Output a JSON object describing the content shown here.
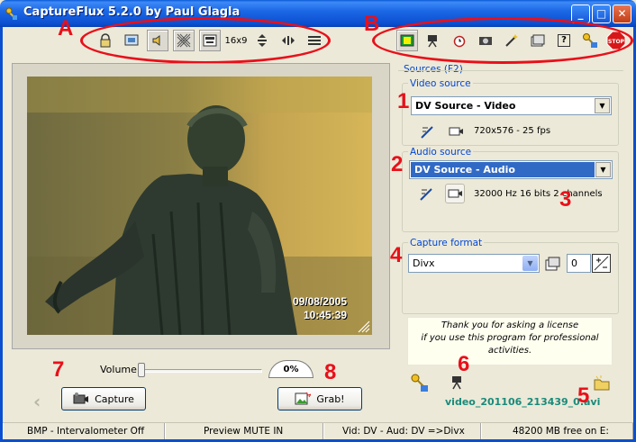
{
  "window": {
    "title": "CaptureFlux 5.2.0 by Paul Glagla",
    "minimize": "_",
    "maximize": "□",
    "close": "✕"
  },
  "toolbar_left": {
    "buttons": [
      {
        "icon": "lock-icon"
      },
      {
        "icon": "display-icon"
      },
      {
        "icon": "speaker-icon",
        "pressed": true
      },
      {
        "icon": "noise-icon",
        "pressed": true
      },
      {
        "icon": "subtitle-icon",
        "pressed": true
      },
      {
        "icon": "aspect-16x9",
        "label": "16x9"
      },
      {
        "icon": "vertical-resize-icon"
      },
      {
        "icon": "horizontal-resize-icon"
      },
      {
        "icon": "lines-icon"
      }
    ]
  },
  "toolbar_right": {
    "buttons": [
      {
        "icon": "film-icon",
        "pressed": true
      },
      {
        "icon": "camera-tripod-icon"
      },
      {
        "icon": "alarm-clock-icon"
      },
      {
        "icon": "camera-icon"
      },
      {
        "icon": "wand-icon"
      },
      {
        "icon": "properties-icon"
      },
      {
        "icon": "help-icon",
        "label": "?"
      },
      {
        "icon": "key-icon"
      },
      {
        "icon": "stop-icon",
        "label": "STOP"
      }
    ]
  },
  "annotations": {
    "A": "A",
    "B": "B",
    "n1": "1",
    "n2": "2",
    "n3": "3",
    "n4": "4",
    "n5": "5",
    "n6": "6",
    "n7": "7",
    "n8": "8"
  },
  "video": {
    "date": "09/08/2005",
    "time": "10:45:39"
  },
  "sources": {
    "title": "Sources (F2)",
    "video_label": "Video source",
    "video_value": "DV Source - Video",
    "video_info": "720x576 - 25 fps",
    "audio_label": "Audio source",
    "audio_value": "DV Source - Audio",
    "audio_info": "32000 Hz 16 bits 2 channels"
  },
  "capture_format": {
    "label": "Capture format",
    "value": "Divx",
    "spin_value": "0"
  },
  "license": {
    "line1": "Thank you for asking a license",
    "line2": "if you use this program for professional",
    "line3": "activities."
  },
  "output_file": "video_201106_213439_0.avi",
  "volume": {
    "label": "Volume",
    "percent": "0%",
    "level": 0
  },
  "buttons": {
    "capture": "Capture",
    "grab": "Grab!"
  },
  "statusbar": {
    "mode": "BMP - Intervalometer Off",
    "preview": "Preview MUTE IN",
    "codec": "Vid: DV  - Aud: DV =>Divx",
    "disk": "48200 MB free on E:"
  },
  "colors": {
    "annotation_red": "#e8101a",
    "titlebar_blue": "#0a4fd0",
    "group_label_blue": "#0046d5",
    "filename_teal": "#1a8a7a",
    "selection_blue": "#316ac5"
  }
}
